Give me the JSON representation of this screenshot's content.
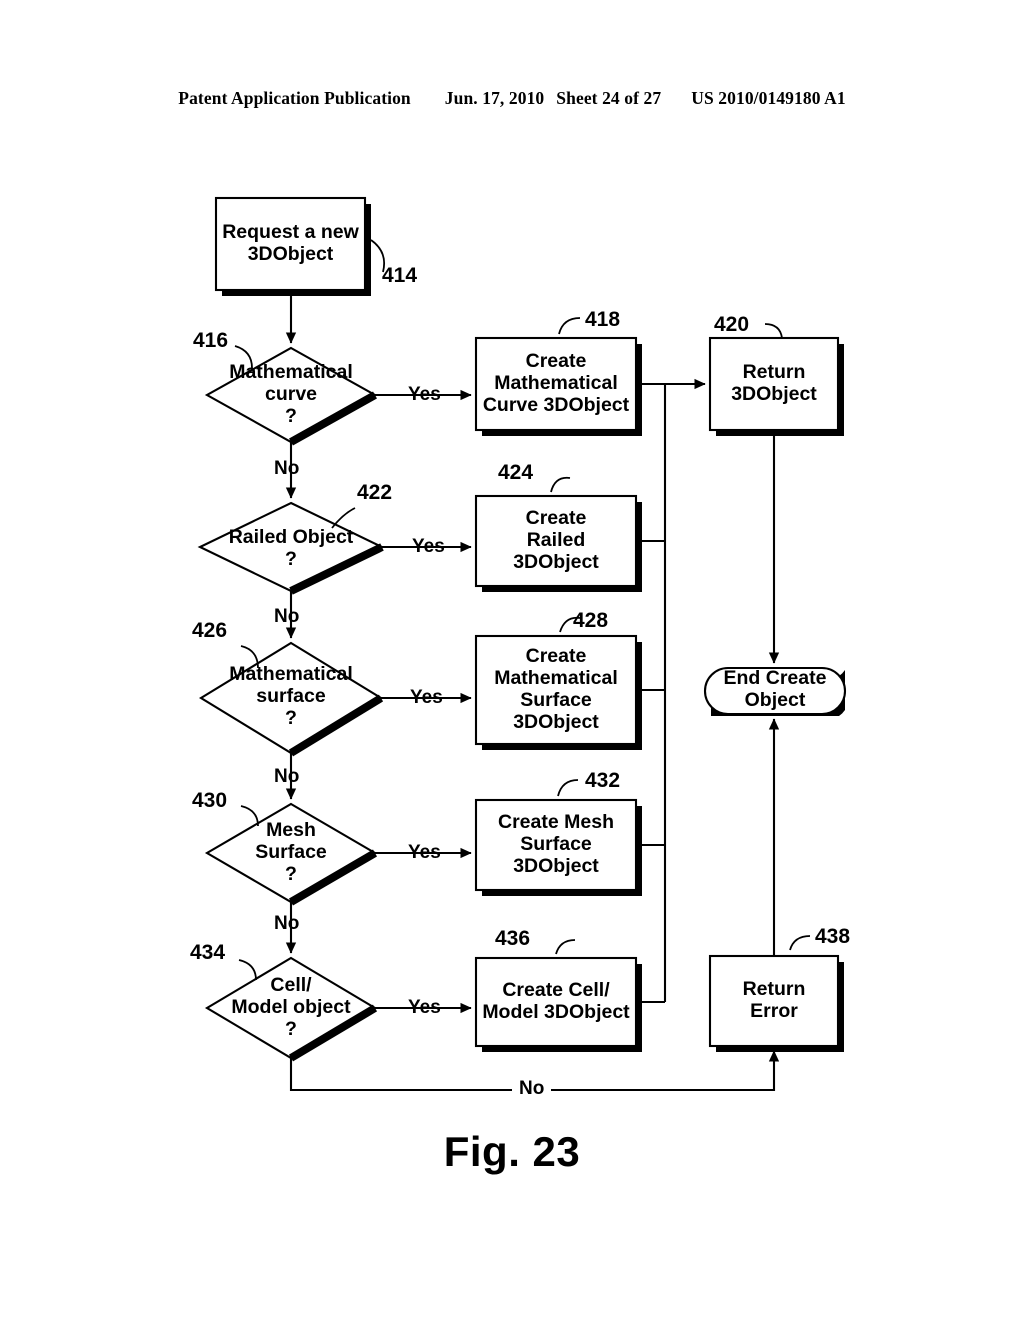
{
  "header": {
    "publication": "Patent Application Publication",
    "date": "Jun. 17, 2010",
    "sheet": "Sheet 24 of 27",
    "patent_number": "US 2010/0149180 A1"
  },
  "figure": {
    "caption": "Fig. 23",
    "title": "Create 3DObject flowchart"
  },
  "nodes": {
    "start": {
      "ref": "414",
      "text": "Request a new\n3DObject",
      "shape": "process"
    },
    "d_curve": {
      "ref": "416",
      "text": "Mathematical\ncurve\n?",
      "shape": "decision"
    },
    "p_curve": {
      "ref": "418",
      "text": "Create\nMathematical\nCurve 3DObject",
      "shape": "process"
    },
    "p_return": {
      "ref": "420",
      "text": "Return\n3DObject",
      "shape": "process"
    },
    "d_railed": {
      "ref": "422",
      "text": "Railed Object\n?",
      "shape": "decision"
    },
    "p_railed": {
      "ref": "424",
      "text": "Create\nRailed\n3DObject",
      "shape": "process"
    },
    "d_surface": {
      "ref": "426",
      "text": "Mathematical\nsurface\n?",
      "shape": "decision"
    },
    "p_surface": {
      "ref": "428",
      "text": "Create\nMathematical\nSurface\n3DObject",
      "shape": "process"
    },
    "d_mesh": {
      "ref": "430",
      "text": "Mesh\nSurface\n?",
      "shape": "decision"
    },
    "p_mesh": {
      "ref": "432",
      "text": "Create Mesh\nSurface\n3DObject",
      "shape": "process"
    },
    "d_cell": {
      "ref": "434",
      "text": "Cell/\nModel object\n?",
      "shape": "decision"
    },
    "p_cell": {
      "ref": "436",
      "text": "Create Cell/\nModel 3DObject",
      "shape": "process"
    },
    "p_error": {
      "ref": "438",
      "text": "Return\nError",
      "shape": "process"
    },
    "end": {
      "ref": "",
      "text": "End Create\nObject",
      "shape": "terminator"
    }
  },
  "edge_labels": {
    "yes1": "Yes",
    "no1": "No",
    "yes2": "Yes",
    "no2": "No",
    "yes3": "Yes",
    "no3": "No",
    "yes4": "Yes",
    "no4": "No",
    "yes5": "Yes",
    "no5": "No"
  },
  "colors": {
    "ink": "#000000",
    "paper": "#ffffff"
  }
}
